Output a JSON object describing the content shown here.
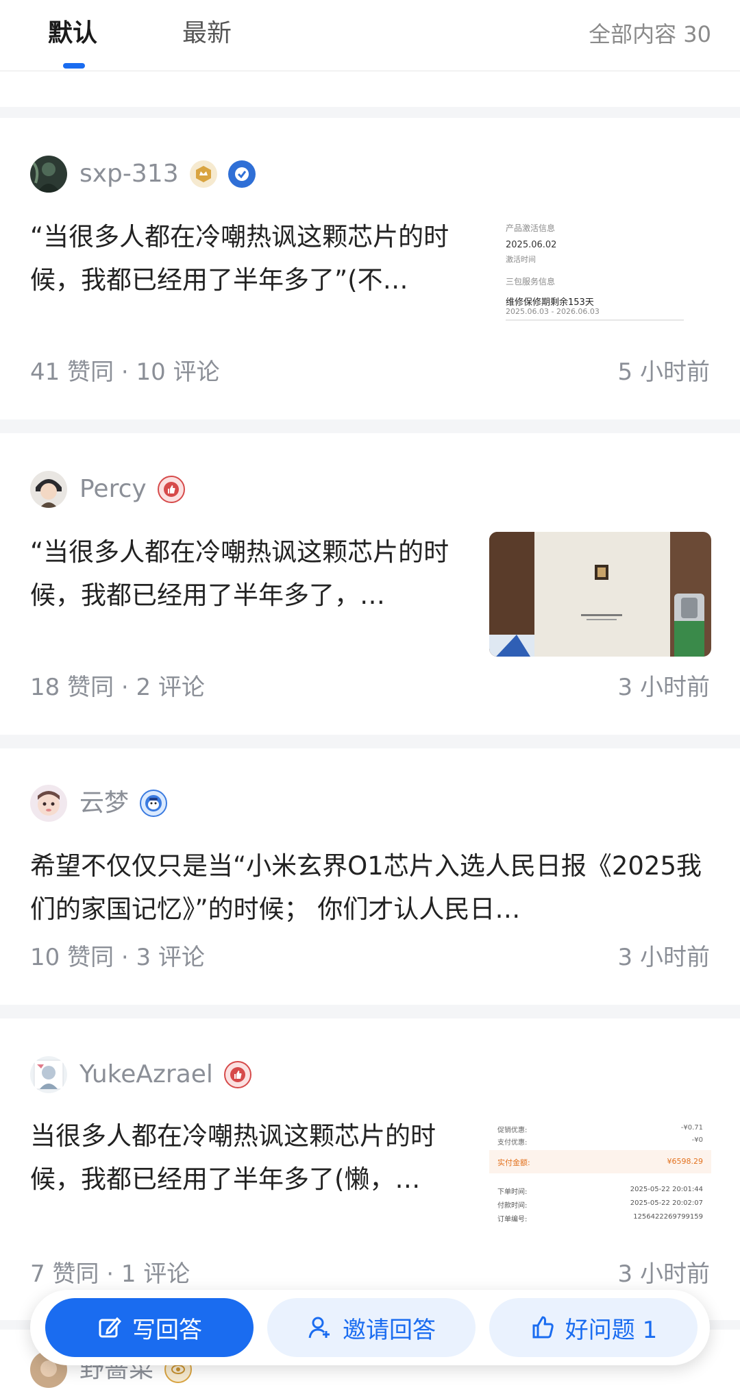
{
  "tabs": {
    "default_label": "默认",
    "latest_label": "最新",
    "total_count": "全部内容 30"
  },
  "answers": [
    {
      "author": "sxp-313",
      "excerpt": "“当很多人都在冷嘲热讽这颗芯片的时候，我都已经用了半年多了”(不…",
      "stats": "41 赞同 · 10 评论",
      "time": "5 小时前",
      "thumb": {
        "t1": "产品激活信息",
        "t2": "2025.06.02",
        "t3": "激活时间",
        "t4": "三包服务信息",
        "t5": "维修保修期剩余153天",
        "t6": "2025.06.03 - 2026.06.03"
      }
    },
    {
      "author": "Percy",
      "excerpt": "“当很多人都在冷嘲热讽这颗芯片的时 候，我都已经用了半年多了，…",
      "stats": "18 赞同 · 2 评论",
      "time": "3 小时前"
    },
    {
      "author": "云梦",
      "excerpt": "希望不仅仅只是当“小米玄界O1芯片入选人民日报《2025我们的家国记忆》”的时候； 你们才认人民日…",
      "stats": "10 赞同 · 3 评论",
      "time": "3 小时前"
    },
    {
      "author": "YukeAzrael",
      "excerpt": "当很多人都在冷嘲热讽这颗芯片的时候，我都已经用了半年多了(懒，…",
      "stats": "7 赞同 · 1 评论",
      "time": "3 小时前",
      "thumb": {
        "r1_label": "促销优惠:",
        "r1_value": "-¥0.71",
        "r2_label": "支付优惠:",
        "r2_value": "-¥0",
        "r3_label": "实付金额:",
        "r3_value": "¥6598.29",
        "r4_label": "下单时间:",
        "r4_value": "2025-05-22 20:01:44",
        "r5_label": "付款时间:",
        "r5_value": "2025-05-22 20:02:07",
        "r6_label": "订单编号:",
        "r6_value": "1256422269799159"
      }
    },
    {
      "author": "野蔷菜"
    }
  ],
  "actions": {
    "write_label": "写回答",
    "invite_label": "邀请回答",
    "good_label": "好问题 1"
  },
  "colors": {
    "accent": "#1a6cf0",
    "meta": "#8b8f97"
  }
}
